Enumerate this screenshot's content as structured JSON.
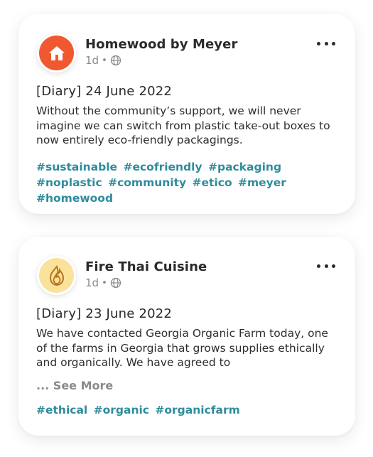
{
  "posts": [
    {
      "author": "Homewood by Meyer",
      "age": "1d",
      "separator": "•",
      "visibility_icon": "globe-icon",
      "avatar_icon": "house-icon",
      "avatar_color": "#f0582f",
      "title": "[Diary] 24 June 2022",
      "body": "Without the community’s support, we will never imagine we can switch from plastic take-out boxes to now entirely eco-friendly packagings.",
      "tags": [
        "#sustainable",
        "#ecofriendly",
        "#packaging",
        "#noplastic",
        "#community",
        "#etico",
        "#meyer",
        "#homewood"
      ]
    },
    {
      "author": "Fire Thai Cuisine",
      "age": "1d",
      "separator": "•",
      "visibility_icon": "globe-icon",
      "avatar_icon": "flame-icon",
      "avatar_color": "#fbe29a",
      "title": "[Diary] 23 June 2022",
      "body": "We have contacted Georgia Organic Farm today, one of the farms in Georgia that grows supplies ethically and organically. We have agreed to",
      "see_more": "... See More",
      "tags": [
        "#ethical",
        "#organic",
        "#organicfarm"
      ]
    }
  ],
  "colors": {
    "accent_tag": "#2f8c9c",
    "muted_text": "#8a8a8a",
    "primary_text": "#2a2a2a"
  }
}
